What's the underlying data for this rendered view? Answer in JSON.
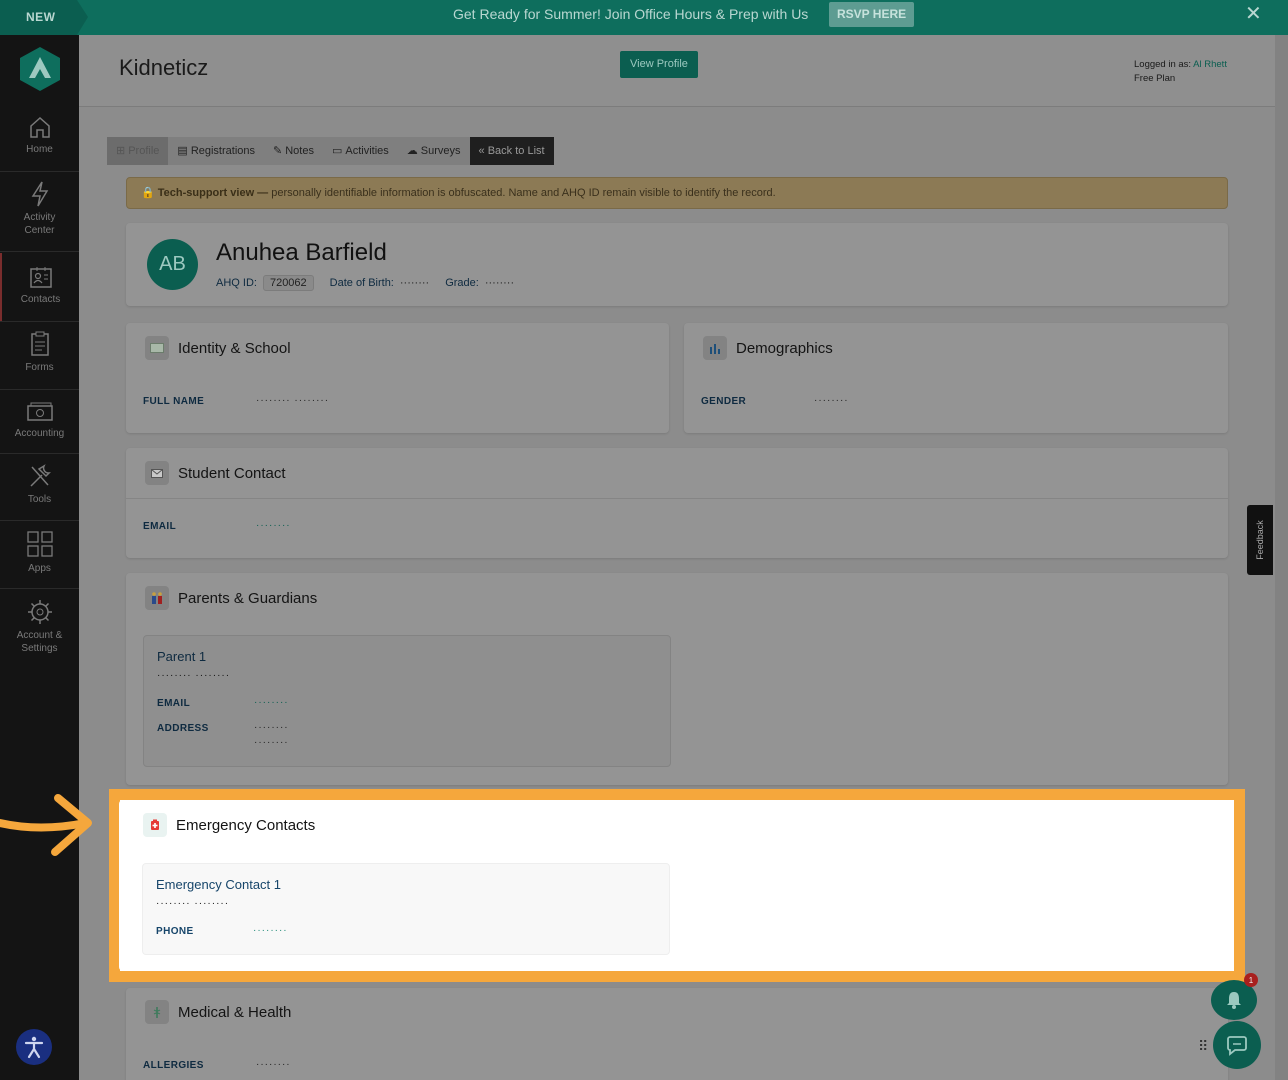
{
  "banner": {
    "new_label": "NEW",
    "message": "Get Ready for Summer! Join Office Hours & Prep with Us",
    "cta": "RSVP HERE",
    "close": "✕"
  },
  "sidebar": {
    "items": [
      {
        "label": "Home",
        "icon": "home-icon"
      },
      {
        "label": "Activity\nCenter",
        "icon": "lightning-icon"
      },
      {
        "label": "Contacts",
        "icon": "contacts-icon"
      },
      {
        "label": "Forms",
        "icon": "clipboard-icon"
      },
      {
        "label": "Accounting",
        "icon": "money-icon"
      },
      {
        "label": "Tools",
        "icon": "tools-icon"
      },
      {
        "label": "Apps",
        "icon": "apps-grid-icon"
      },
      {
        "label": "Account &\nSettings",
        "icon": "gear-icon"
      }
    ]
  },
  "header": {
    "org_name": "Kidneticz",
    "view_profile": "View Profile",
    "logged_in_as": "Logged in as:",
    "user": "Al Rhett",
    "plan": "Free Plan"
  },
  "tabs": [
    {
      "label": "Profile",
      "icon": "profile-icon"
    },
    {
      "label": "Registrations",
      "icon": "registrations-icon"
    },
    {
      "label": "Notes",
      "icon": "notes-icon"
    },
    {
      "label": "Activities",
      "icon": "activities-icon"
    },
    {
      "label": "Surveys",
      "icon": "cloud-icon"
    },
    {
      "label": "« Back to List"
    }
  ],
  "notice": {
    "bold": "Tech-support view —",
    "text": " personally identifiable information is obfuscated. Name and AHQ ID remain visible to identify the record."
  },
  "profile": {
    "initials": "AB",
    "name": "Anuhea Barfield",
    "ahq_label": "AHQ ID:",
    "ahq_id": "720062",
    "dob_label": "Date of Birth:",
    "dob": "········",
    "grade_label": "Grade:",
    "grade": "········"
  },
  "identity": {
    "title": "Identity & School",
    "field_label": "FULL NAME",
    "field_value": "········ ········"
  },
  "demographics": {
    "title": "Demographics",
    "field_label": "GENDER",
    "field_value": "········"
  },
  "student_contact": {
    "title": "Student Contact",
    "field_label": "EMAIL",
    "field_value": "········"
  },
  "parents": {
    "title": "Parents & Guardians",
    "parent_title": "Parent 1",
    "parent_name": "········ ········",
    "email_label": "EMAIL",
    "email_value": "········",
    "address_label": "ADDRESS",
    "address_line1": "········",
    "address_line2": "········"
  },
  "emergency": {
    "title": "Emergency Contacts",
    "contact_title": "Emergency Contact 1",
    "contact_name": "········ ········",
    "phone_label": "PHONE",
    "phone_value": "········"
  },
  "medical": {
    "title": "Medical & Health",
    "field_label": "ALLERGIES",
    "field_value": "········"
  },
  "feedback": "Feedback",
  "notifications": {
    "count": "1"
  },
  "colors": {
    "brand": "#0b5e50",
    "highlight": "#f5a73c",
    "banner": "#0e6e5d"
  }
}
